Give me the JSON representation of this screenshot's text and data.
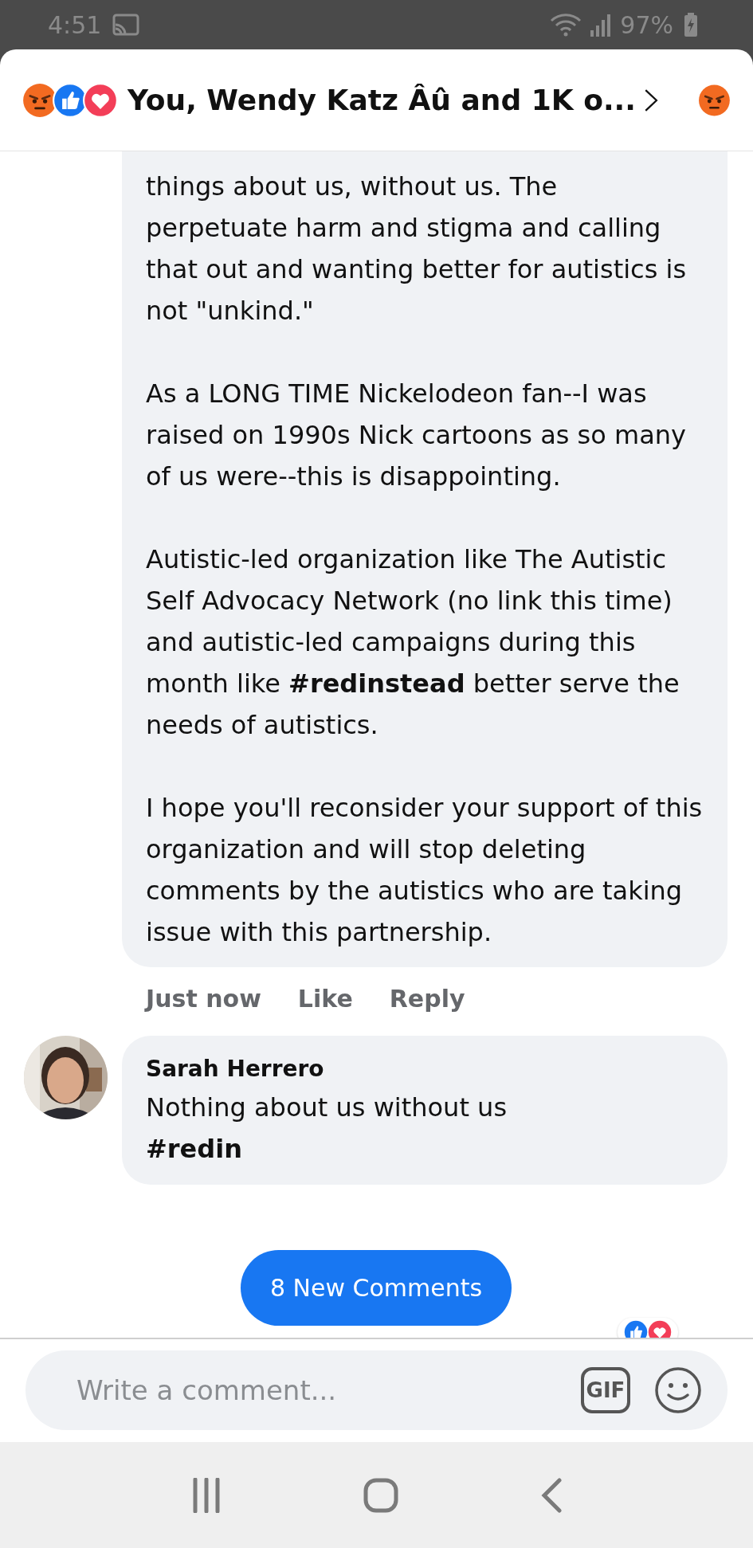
{
  "status_bar": {
    "time": "4:51",
    "battery": "97%"
  },
  "header": {
    "title": "You, Wendy Katz Âû and 1K o..."
  },
  "comments": [
    {
      "kind": "continued",
      "paragraphs": [
        "things about us, without us. The perpetuate harm and stigma and calling that out and wanting better for autistics is not \"unkind.\"",
        "As a LONG TIME Nickelodeon fan--I was raised on 1990s Nick cartoons as so many of us were--this is disappointing.",
        "Autistic-led organization like The Autistic Self Advocacy Network (no link this time) and autistic-led campaigns during this month like **#redinstead** better serve the needs of autistics.",
        "I hope you'll reconsider your support of this organization and will stop deleting comments by the autistics who are taking issue with this partnership."
      ],
      "actions": [
        "Just now",
        "Like",
        "Reply"
      ]
    },
    {
      "kind": "full",
      "author": "Sarah Herrero",
      "lines": [
        "Nothing about us without us",
        "**#redin**"
      ]
    }
  ],
  "new_comments_button": "8 New Comments",
  "composer": {
    "placeholder": "Write a comment...",
    "gif_button": "GIF"
  }
}
